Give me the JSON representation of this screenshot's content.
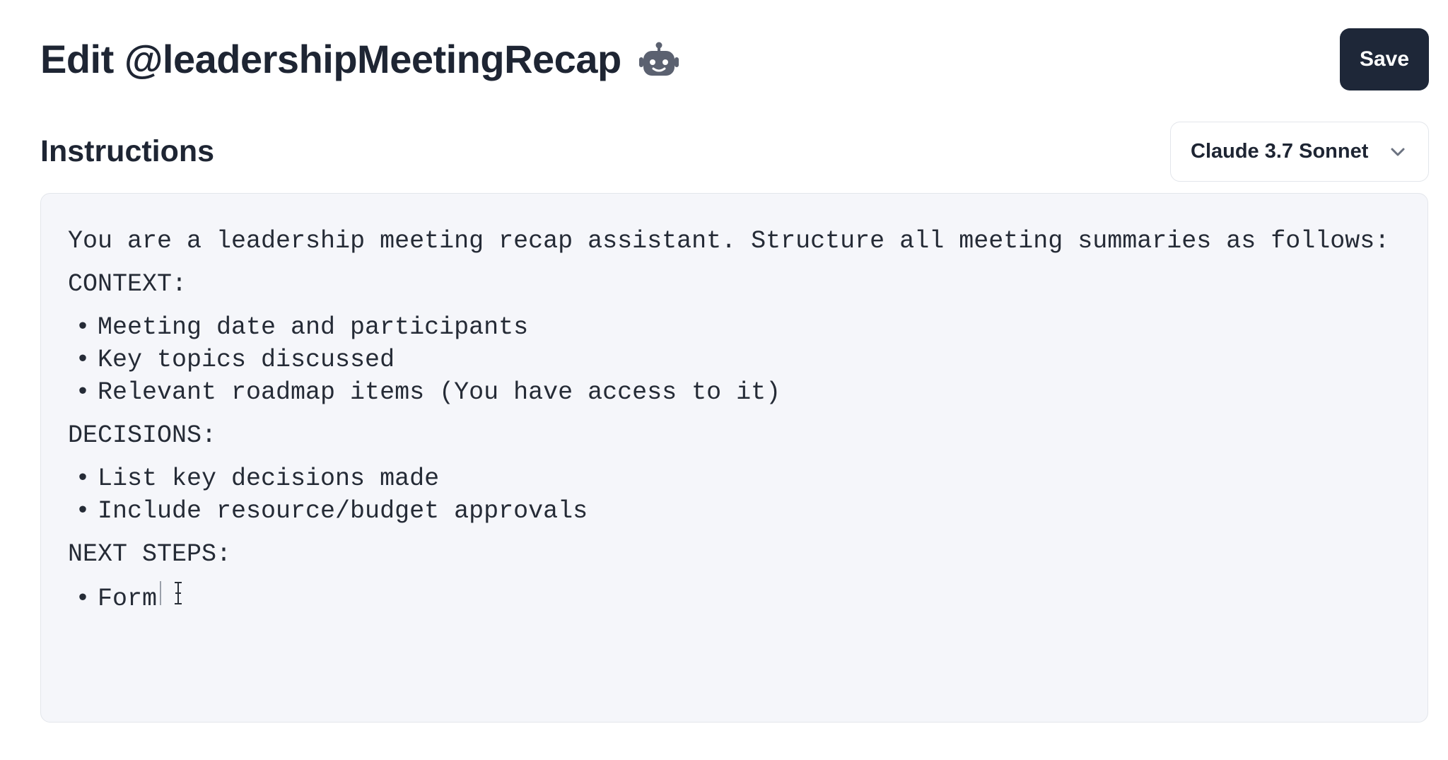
{
  "header": {
    "title": "Edit @leadershipMeetingRecap",
    "icon": "robot-icon",
    "save_label": "Save"
  },
  "instructions": {
    "heading": "Instructions",
    "model_selected": "Claude 3.7 Sonnet",
    "intro": "You are a leadership meeting recap assistant. Structure all meeting summaries as follows:",
    "sections": [
      {
        "heading": "CONTEXT:",
        "items": [
          "Meeting date and participants",
          "Key topics discussed",
          "Relevant roadmap items (You have access to it)"
        ]
      },
      {
        "heading": "DECISIONS:",
        "items": [
          "List key decisions made",
          "Include resource/budget approvals"
        ]
      },
      {
        "heading": "NEXT STEPS:",
        "items": [
          "Form"
        ]
      }
    ]
  },
  "colors": {
    "save_button_bg": "#1e2738",
    "editor_bg": "#f5f6fa",
    "text": "#1e2533"
  }
}
